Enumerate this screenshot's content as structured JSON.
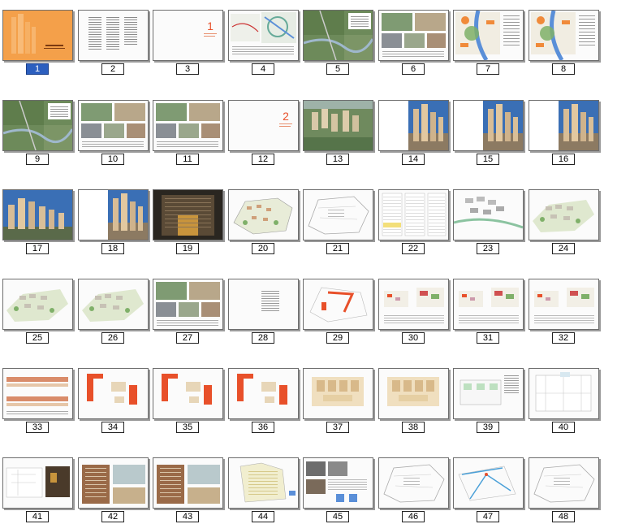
{
  "slides": [
    {
      "num": "1",
      "kind": "cover",
      "selected": true
    },
    {
      "num": "2",
      "kind": "toc"
    },
    {
      "num": "3",
      "kind": "section",
      "section_number": "1"
    },
    {
      "num": "4",
      "kind": "map"
    },
    {
      "num": "5",
      "kind": "aerial-map"
    },
    {
      "num": "6",
      "kind": "photos"
    },
    {
      "num": "7",
      "kind": "map-color"
    },
    {
      "num": "8",
      "kind": "map-color"
    },
    {
      "num": "9",
      "kind": "aerial-map"
    },
    {
      "num": "10",
      "kind": "photos"
    },
    {
      "num": "11",
      "kind": "photos"
    },
    {
      "num": "12",
      "kind": "section",
      "section_number": "2"
    },
    {
      "num": "13",
      "kind": "render-aerial"
    },
    {
      "num": "14",
      "kind": "render-towers"
    },
    {
      "num": "15",
      "kind": "render-towers"
    },
    {
      "num": "16",
      "kind": "render-towers"
    },
    {
      "num": "17",
      "kind": "render-towers-wide"
    },
    {
      "num": "18",
      "kind": "render-towers"
    },
    {
      "num": "19",
      "kind": "render-night"
    },
    {
      "num": "20",
      "kind": "site-plan"
    },
    {
      "num": "21",
      "kind": "site-plan-line"
    },
    {
      "num": "22",
      "kind": "table"
    },
    {
      "num": "23",
      "kind": "massing"
    },
    {
      "num": "24",
      "kind": "massing-green"
    },
    {
      "num": "25",
      "kind": "massing-green"
    },
    {
      "num": "26",
      "kind": "massing-green"
    },
    {
      "num": "27",
      "kind": "photos"
    },
    {
      "num": "28",
      "kind": "text-page"
    },
    {
      "num": "29",
      "kind": "site-plan-red"
    },
    {
      "num": "30",
      "kind": "massing-red"
    },
    {
      "num": "31",
      "kind": "massing-red"
    },
    {
      "num": "32",
      "kind": "massing-red"
    },
    {
      "num": "33",
      "kind": "elevations"
    },
    {
      "num": "34",
      "kind": "floor-plans-red"
    },
    {
      "num": "35",
      "kind": "floor-plans-red"
    },
    {
      "num": "36",
      "kind": "floor-plans-red"
    },
    {
      "num": "37",
      "kind": "floor-plan"
    },
    {
      "num": "38",
      "kind": "floor-plan"
    },
    {
      "num": "39",
      "kind": "floor-plan-green"
    },
    {
      "num": "40",
      "kind": "floor-plan-line"
    },
    {
      "num": "41",
      "kind": "floor-plan-photo"
    },
    {
      "num": "42",
      "kind": "facade"
    },
    {
      "num": "43",
      "kind": "facade"
    },
    {
      "num": "44",
      "kind": "plan-yellow"
    },
    {
      "num": "45",
      "kind": "photos-small"
    },
    {
      "num": "46",
      "kind": "site-plan-line"
    },
    {
      "num": "47",
      "kind": "site-plan-blue"
    },
    {
      "num": "48",
      "kind": "site-plan-line"
    }
  ],
  "colors": {
    "selected_thumb": "#f4a04a",
    "selected_label_bg": "#2c5fbf",
    "accent_red": "#e8502a",
    "green": "#7fb069",
    "sky": "#3a6fb5"
  }
}
